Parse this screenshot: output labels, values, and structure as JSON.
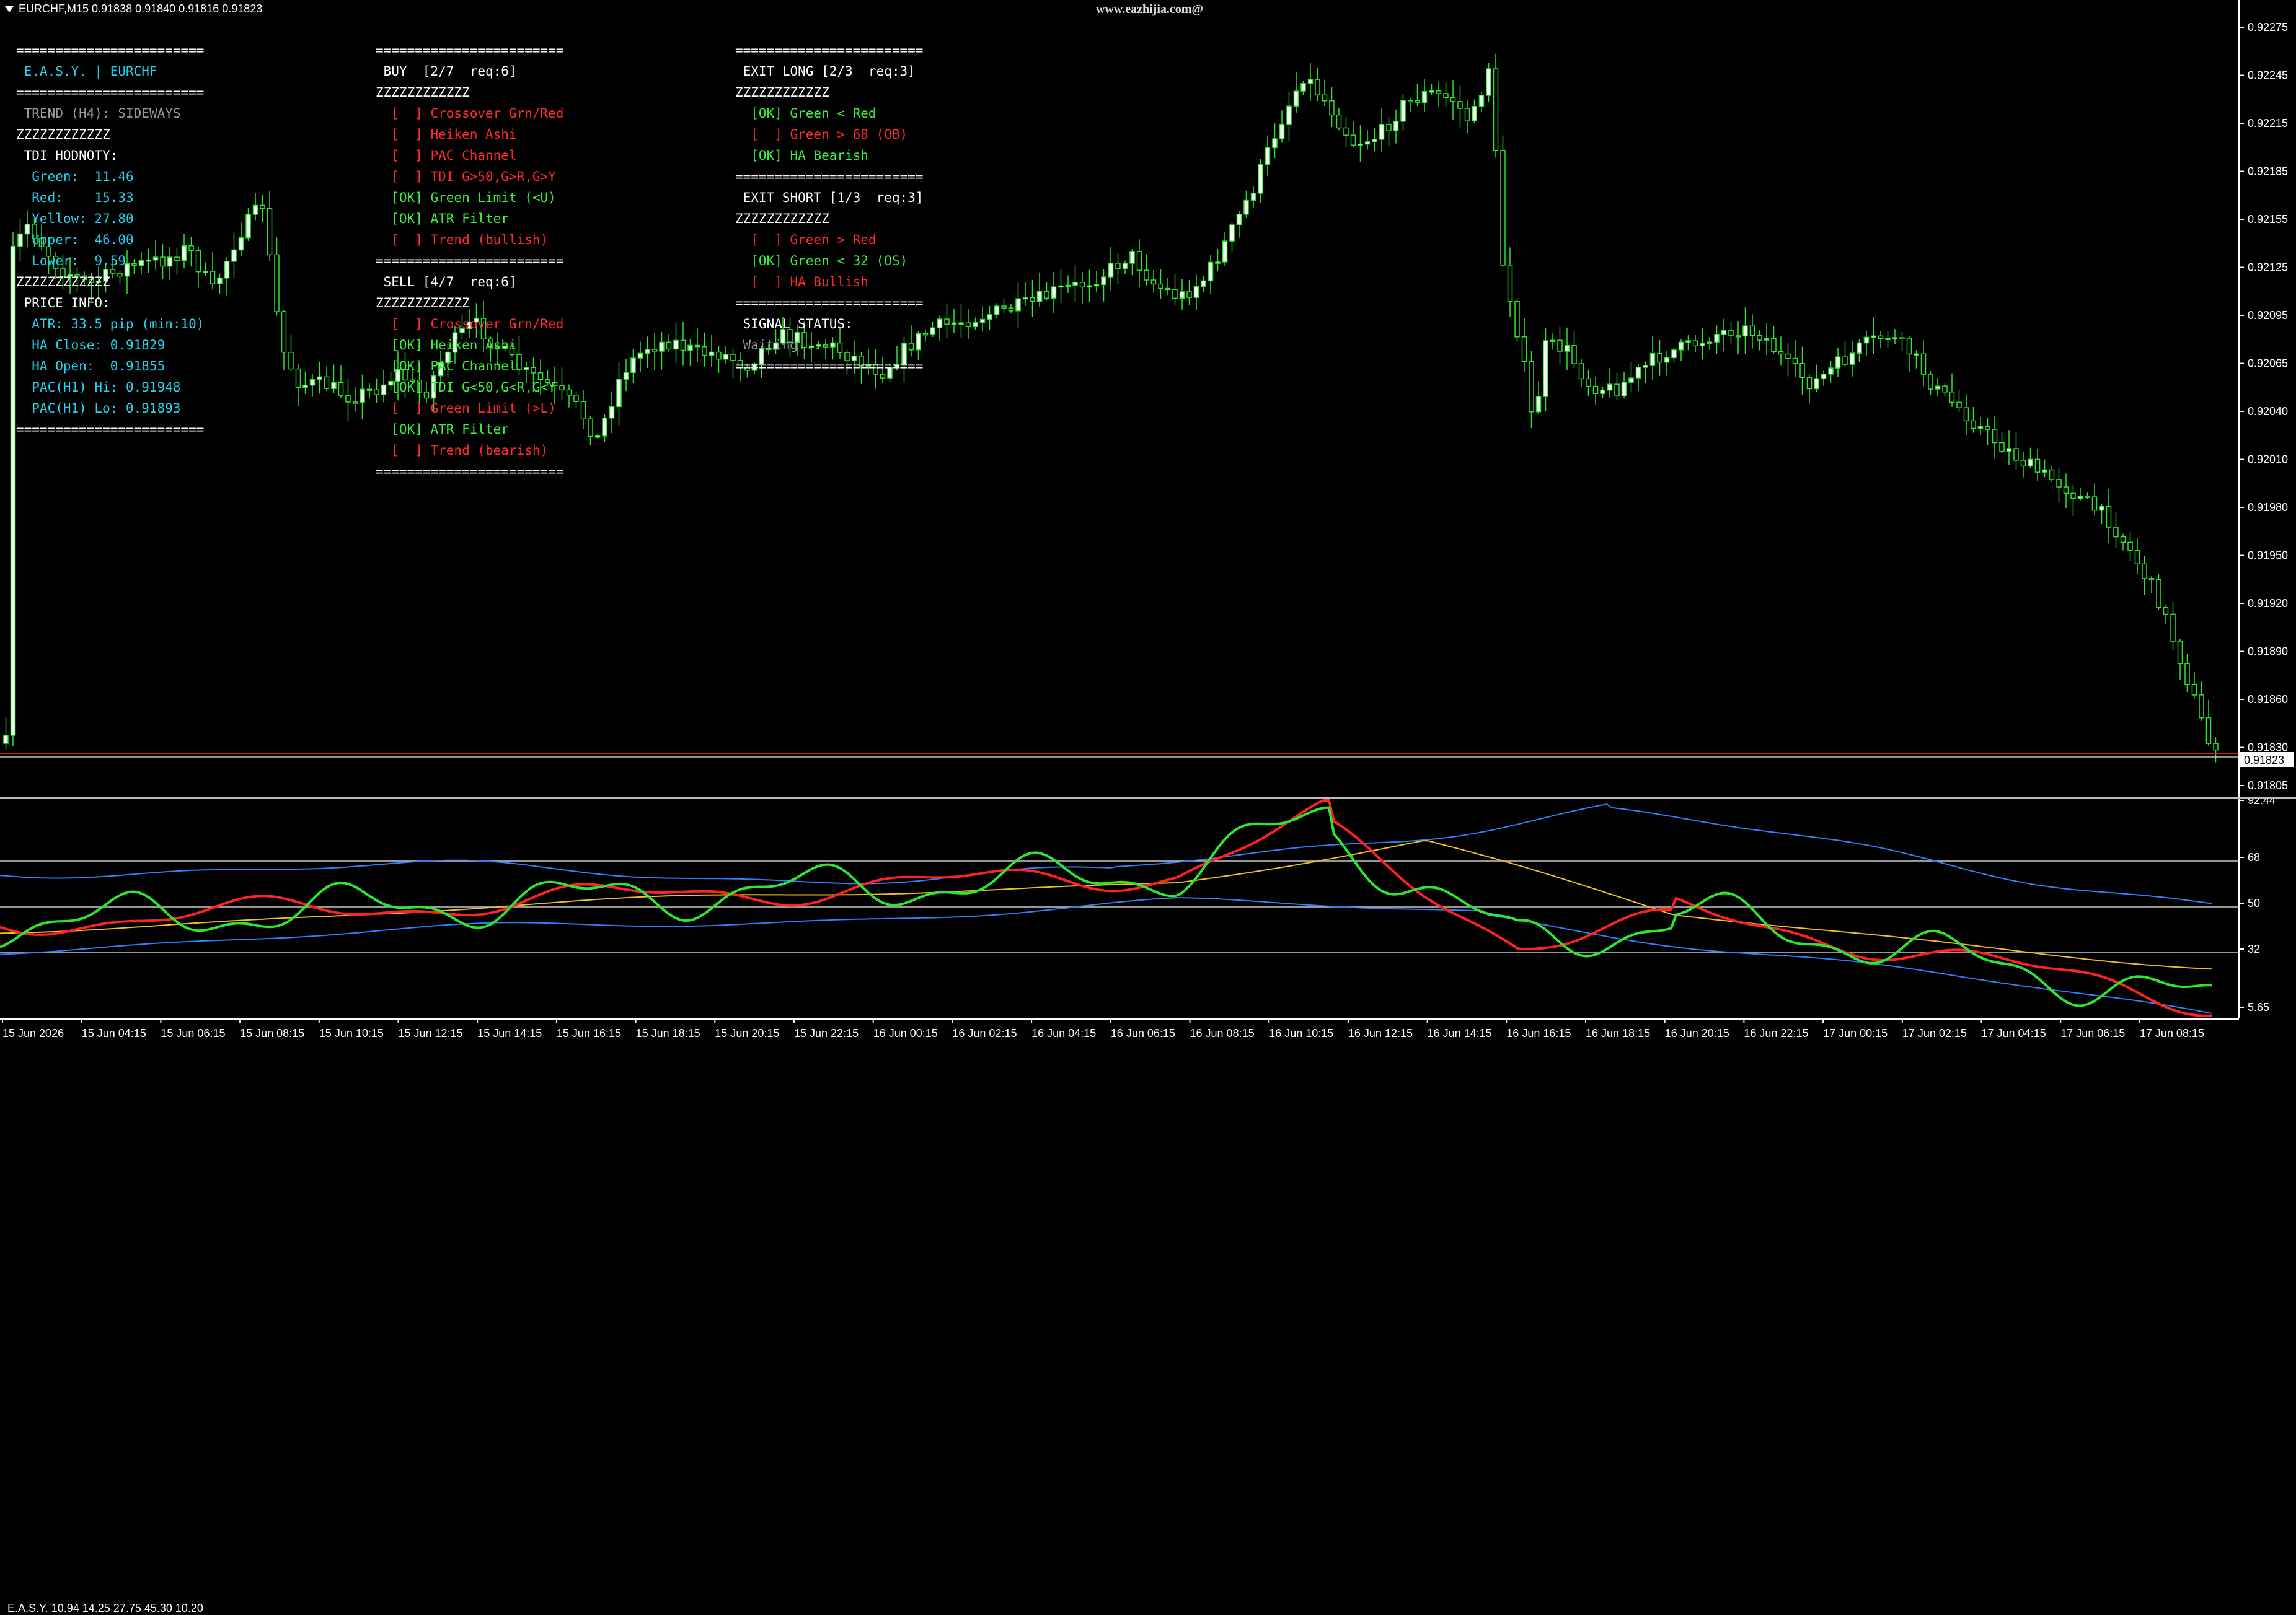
{
  "header": {
    "symbol_line": "EURCHF,M15  0.91838 0.91840 0.91816 0.91823",
    "watermark": "www.eazhijia.com@"
  },
  "price_axis": {
    "labels": [
      "0.92275",
      "0.92245",
      "0.92215",
      "0.92185",
      "0.92155",
      "0.92125",
      "0.92095",
      "0.92065",
      "0.92040",
      "0.92010",
      "0.91980",
      "0.91950",
      "0.91920",
      "0.91890",
      "0.91860",
      "0.91830",
      "0.91805"
    ],
    "current_price": "0.91823"
  },
  "indicator": {
    "label": "E.A.S.Y. 10.94 14.25 27.75 45.30 10.20",
    "axis_labels": [
      "92.44",
      "68",
      "50",
      "32",
      "5.65"
    ]
  },
  "time_axis": {
    "labels": [
      "15 Jun 2026",
      "15 Jun 04:15",
      "15 Jun 06:15",
      "15 Jun 08:15",
      "15 Jun 10:15",
      "15 Jun 12:15",
      "15 Jun 14:15",
      "15 Jun 16:15",
      "15 Jun 18:15",
      "15 Jun 20:15",
      "15 Jun 22:15",
      "16 Jun 00:15",
      "16 Jun 02:15",
      "16 Jun 04:15",
      "16 Jun 06:15",
      "16 Jun 08:15",
      "16 Jun 10:15",
      "16 Jun 12:15",
      "16 Jun 14:15",
      "16 Jun 16:15",
      "16 Jun 18:15",
      "16 Jun 20:15",
      "16 Jun 22:15",
      "17 Jun 00:15",
      "17 Jun 02:15",
      "17 Jun 04:15",
      "17 Jun 06:15",
      "17 Jun 08:15"
    ]
  },
  "panel_left": {
    "lines": [
      {
        "text": "========================",
        "cls": "w"
      },
      {
        "text": " E.A.S.Y. | EURCHF",
        "cls": "c"
      },
      {
        "text": "========================",
        "cls": "w"
      },
      {
        "text": " TREND (H4): SIDEWAYS",
        "cls": "g"
      },
      {
        "text": "ZZZZZZZZZZZZ",
        "cls": "w"
      },
      {
        "text": " TDI HODNOTY:",
        "cls": "w"
      },
      {
        "text": "  Green:  11.46",
        "cls": "c"
      },
      {
        "text": "  Red:    15.33",
        "cls": "c"
      },
      {
        "text": "  Yellow: 27.80",
        "cls": "c"
      },
      {
        "text": "  Upper:  46.00",
        "cls": "c"
      },
      {
        "text": "  Lower:  9.59",
        "cls": "c"
      },
      {
        "text": "ZZZZZZZZZZZZ",
        "cls": "w"
      },
      {
        "text": " PRICE INFO:",
        "cls": "w"
      },
      {
        "text": "  ATR: 33.5 pip (min:10)",
        "cls": "c"
      },
      {
        "text": "  HA Close: 0.91829",
        "cls": "c"
      },
      {
        "text": "  HA Open:  0.91855",
        "cls": "c"
      },
      {
        "text": "  PAC(H1) Hi: 0.91948",
        "cls": "c"
      },
      {
        "text": "  PAC(H1) Lo: 0.91893",
        "cls": "c"
      },
      {
        "text": "========================",
        "cls": "w"
      }
    ]
  },
  "panel_middle": {
    "lines": [
      {
        "text": "========================",
        "cls": "w"
      },
      {
        "text": " BUY  [2/7  req:6]",
        "cls": "w"
      },
      {
        "text": "ZZZZZZZZZZZZ",
        "cls": "w"
      },
      {
        "text": "  [  ] Crossover Grn/Red",
        "cls": "red"
      },
      {
        "text": "  [  ] Heiken Ashi",
        "cls": "red"
      },
      {
        "text": "  [  ] PAC Channel",
        "cls": "red"
      },
      {
        "text": "  [  ] TDI G>50,G>R,G>Y",
        "cls": "red"
      },
      {
        "text": "  [OK] Green Limit (<U)",
        "cls": "lime"
      },
      {
        "text": "  [OK] ATR Filter",
        "cls": "lime"
      },
      {
        "text": "  [  ] Trend (bullish)",
        "cls": "red"
      },
      {
        "text": "========================",
        "cls": "w"
      },
      {
        "text": " SELL [4/7  req:6]",
        "cls": "w"
      },
      {
        "text": "ZZZZZZZZZZZZ",
        "cls": "w"
      },
      {
        "text": "  [  ] Crossover Grn/Red",
        "cls": "red"
      },
      {
        "text": "  [OK] Heiken Ashi",
        "cls": "lime"
      },
      {
        "text": "  [OK] PAC Channel",
        "cls": "lime"
      },
      {
        "text": "  [OK] TDI G<50,G<R,G<Y",
        "cls": "lime"
      },
      {
        "text": "  [  ] Green Limit (>L)",
        "cls": "red"
      },
      {
        "text": "  [OK] ATR Filter",
        "cls": "lime"
      },
      {
        "text": "  [  ] Trend (bearish)",
        "cls": "red"
      },
      {
        "text": "========================",
        "cls": "w"
      }
    ]
  },
  "panel_right": {
    "lines": [
      {
        "text": "========================",
        "cls": "w"
      },
      {
        "text": " EXIT LONG [2/3  req:3]",
        "cls": "w"
      },
      {
        "text": "ZZZZZZZZZZZZ",
        "cls": "w"
      },
      {
        "text": "  [OK] Green < Red",
        "cls": "lime"
      },
      {
        "text": "  [  ] Green > 68 (OB)",
        "cls": "red"
      },
      {
        "text": "  [OK] HA Bearish",
        "cls": "lime"
      },
      {
        "text": "========================",
        "cls": "w"
      },
      {
        "text": " EXIT SHORT [1/3  req:3]",
        "cls": "w"
      },
      {
        "text": "ZZZZZZZZZZZZ",
        "cls": "w"
      },
      {
        "text": "  [  ] Green > Red",
        "cls": "red"
      },
      {
        "text": "  [OK] Green < 32 (OS)",
        "cls": "lime"
      },
      {
        "text": "  [  ] HA Bullish",
        "cls": "red"
      },
      {
        "text": "========================",
        "cls": "w"
      },
      {
        "text": " SIGNAL STATUS:",
        "cls": "w"
      },
      {
        "text": " Waiting...",
        "cls": "g"
      },
      {
        "text": "========================",
        "cls": "w"
      }
    ]
  }
}
